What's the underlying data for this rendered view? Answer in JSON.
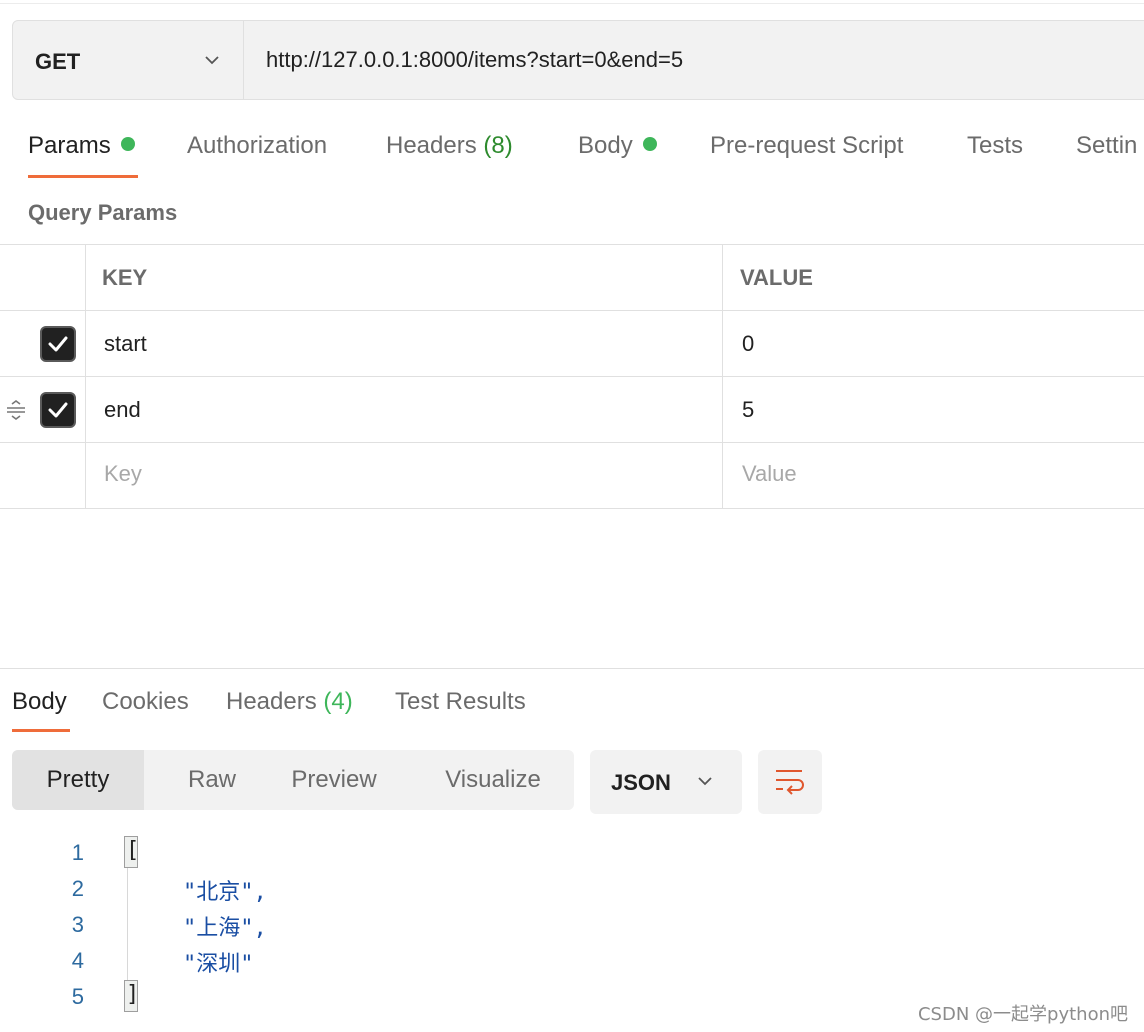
{
  "request": {
    "method": "GET",
    "url": "http://127.0.0.1:8000/items?start=0&end=5"
  },
  "request_tabs": [
    {
      "label": "Params",
      "count": "",
      "dot": true,
      "active": true
    },
    {
      "label": "Authorization",
      "count": "",
      "dot": false,
      "active": false
    },
    {
      "label": "Headers",
      "count": "(8)",
      "dot": false,
      "active": false
    },
    {
      "label": "Body",
      "count": "",
      "dot": true,
      "active": false
    },
    {
      "label": "Pre-request Script",
      "count": "",
      "dot": false,
      "active": false
    },
    {
      "label": "Tests",
      "count": "",
      "dot": false,
      "active": false
    },
    {
      "label": "Settin",
      "count": "",
      "dot": false,
      "active": false
    }
  ],
  "query_params": {
    "section_label": "Query Params",
    "headers": {
      "key": "KEY",
      "value": "VALUE"
    },
    "rows": [
      {
        "key": "start",
        "value": "0",
        "checked": true
      },
      {
        "key": "end",
        "value": "5",
        "checked": true
      }
    ],
    "placeholder": {
      "key": "Key",
      "value": "Value"
    }
  },
  "response_tabs": [
    {
      "label": "Body",
      "count": "",
      "active": true
    },
    {
      "label": "Cookies",
      "count": "",
      "active": false
    },
    {
      "label": "Headers",
      "count": "(4)",
      "active": false
    },
    {
      "label": "Test Results",
      "count": "",
      "active": false
    }
  ],
  "view_modes": [
    "Pretty",
    "Raw",
    "Preview",
    "Visualize"
  ],
  "active_view_mode": "Pretty",
  "format": "JSON",
  "code": {
    "line_numbers": [
      "1",
      "2",
      "3",
      "4",
      "5"
    ],
    "open_bracket": "[",
    "close_bracket": "]",
    "items": [
      "\"北京\",",
      "\"上海\",",
      "\"深圳\""
    ]
  },
  "watermark": "CSDN @一起学python吧",
  "colors": {
    "accent": "#ef6c3a",
    "dot": "#3eb65a",
    "count": "#2e8b2e",
    "string": "#1a4ea3"
  }
}
